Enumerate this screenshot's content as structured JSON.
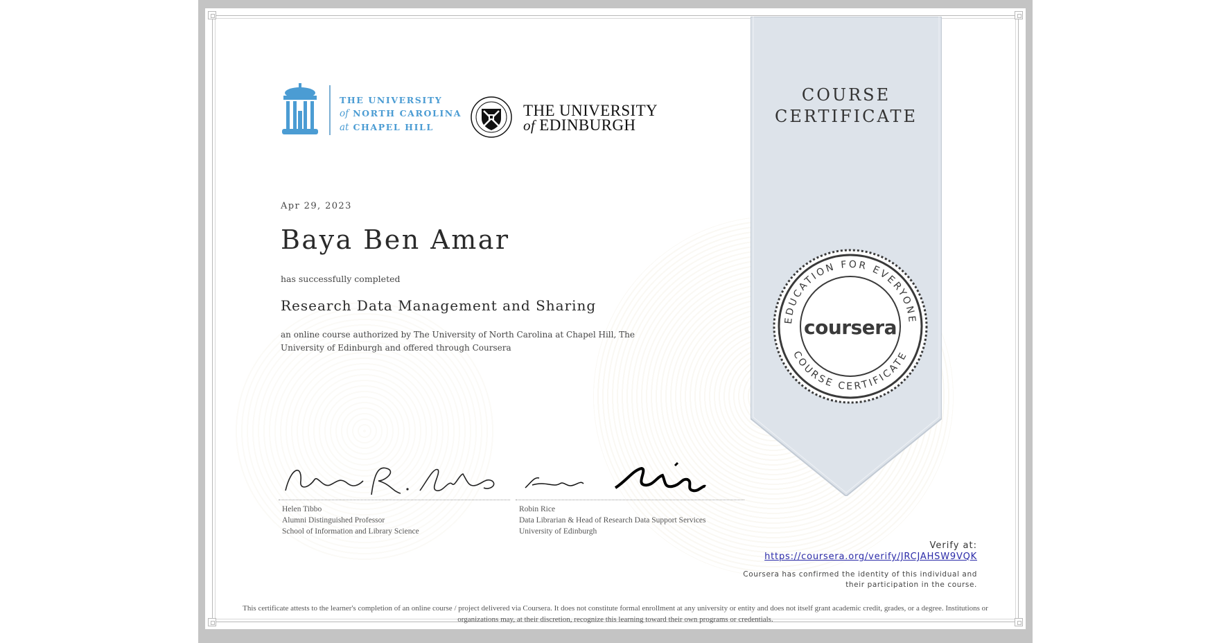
{
  "certificate": {
    "ribbon_title_line1": "COURSE",
    "ribbon_title_line2": "CERTIFICATE",
    "date": "Apr 29, 2023",
    "learner_name": "Baya Ben Amar",
    "completed_text": "has successfully completed",
    "course_title": "Research Data Management and Sharing",
    "description": "an online course authorized by The University of North Carolina at Chapel Hill, The University of Edinburgh and offered through Coursera"
  },
  "logos": {
    "unc": {
      "line1": "THE UNIVERSITY",
      "line2_italic": "of",
      "line2": "NORTH CAROLINA",
      "line3_italic": "at",
      "line3": "CHAPEL HILL",
      "color": "#4b9cd3"
    },
    "edinburgh": {
      "line1": "THE UNIVERSITY",
      "line2_italic": "of",
      "line2": "EDINBURGH"
    }
  },
  "seal": {
    "brand": "coursera",
    "top_arc": "EDUCATION FOR EVERYONE",
    "bottom_arc": "COURSE CERTIFICATE"
  },
  "signatories": [
    {
      "name": "Helen Tibbo",
      "title": "Alumni Distinguished Professor",
      "org": "School of Information and Library Science"
    },
    {
      "name": "Robin Rice",
      "title": "Data Librarian & Head of Research Data Support Services",
      "org": "University of Edinburgh"
    }
  ],
  "verify": {
    "label": "Verify at:",
    "url": "https://coursera.org/verify/JRCJAHSW9VQK",
    "identity_note": "Coursera has confirmed the identity of this individual and their participation in the course."
  },
  "disclaimer": "This certificate attests to the learner's completion of an online course / project delivered via Coursera. It does not constitute formal enrollment at any university or entity and does not itself grant academic credit, grades, or a degree. Institutions or organizations may, at their discretion, recognize this learning toward their own programs or credentials.",
  "colors": {
    "ribbon": "#dde3ea",
    "seal": "#3a3a3a",
    "link": "#2a2aa8",
    "unc_blue": "#4b9cd3"
  }
}
